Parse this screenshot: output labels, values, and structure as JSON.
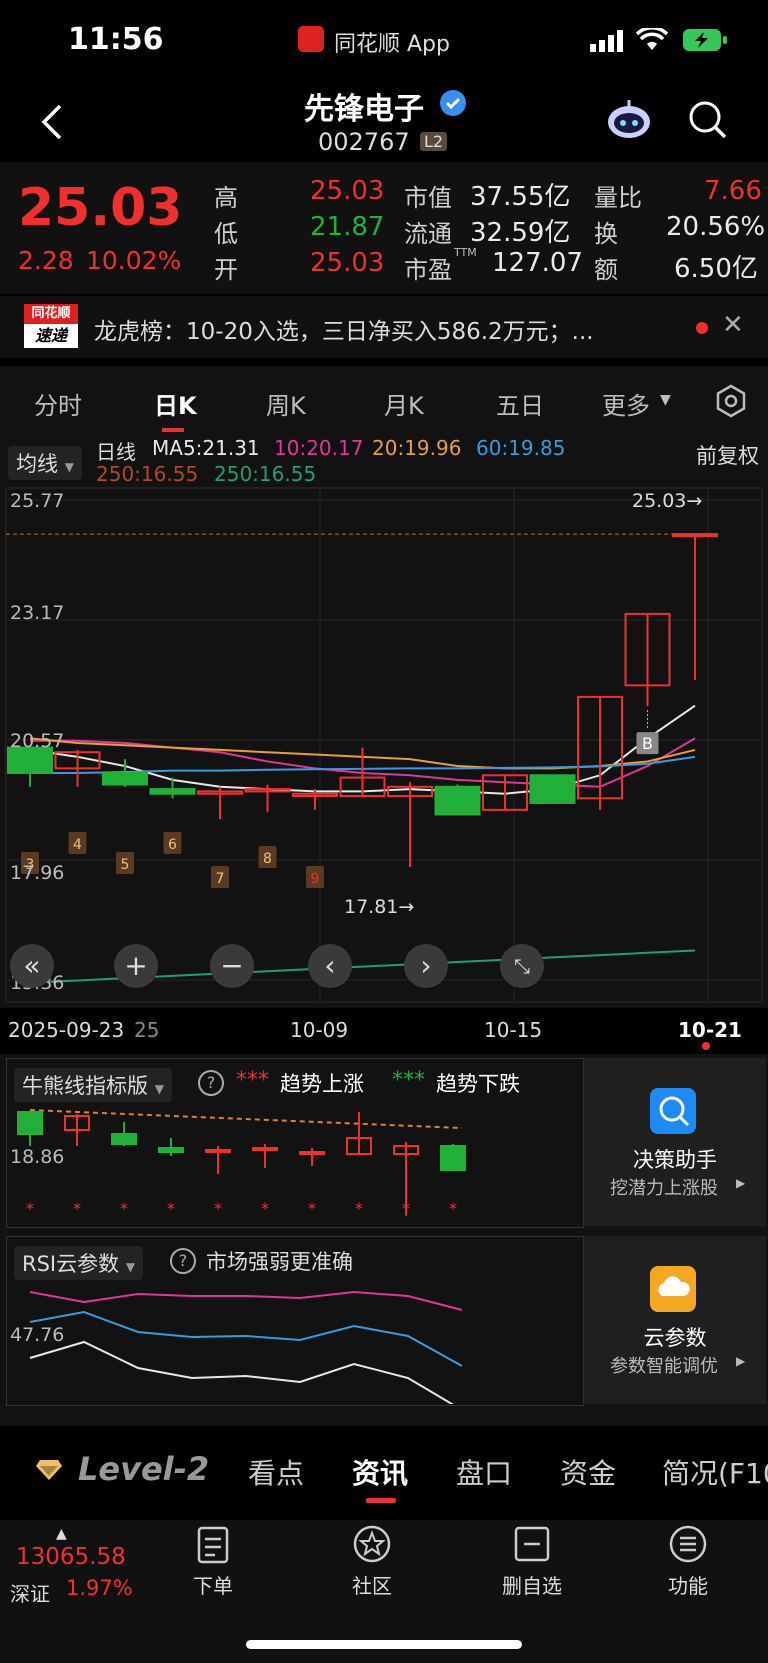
{
  "status_bar": {
    "time": "11:56",
    "app_label": "同花顺 App"
  },
  "header": {
    "stock_name": "先锋电子",
    "stock_code": "002767",
    "level_badge": "L2"
  },
  "quote": {
    "price": "25.03",
    "change": "2.28",
    "change_pct": "10.02%",
    "high_label": "高",
    "high": "25.03",
    "low_label": "低",
    "low": "21.87",
    "open_label": "开",
    "open": "25.03",
    "mktcap_label": "市值",
    "mktcap": "37.55亿",
    "float_label": "流通",
    "float": "32.59亿",
    "pe_label": "市盈",
    "pe_sup": "TTM",
    "pe": "127.07",
    "vol_ratio_label": "量比",
    "vol_ratio": "7.66",
    "turnover_label": "换",
    "turnover": "20.56%",
    "amount_label": "额",
    "amount": "6.50亿"
  },
  "news": {
    "badge_top": "同花顺",
    "badge_bottom": "速递",
    "text": "龙虎榜：10-20入选，三日净买入586.2万元；..."
  },
  "tabs": [
    "分时",
    "日K",
    "周K",
    "月K",
    "五日",
    "更多"
  ],
  "ma_bar": {
    "selector": "均线",
    "line_type": "日线",
    "ma5": "MA5:21.31",
    "ma10": "10:20.17",
    "ma20": "20:19.96",
    "ma60": "60:19.85",
    "ma250a": "250:16.55",
    "ma250b": "250:16.55",
    "adjust": "前复权"
  },
  "chart_data": {
    "type": "candlestick",
    "y_ticks": [
      "25.77",
      "23.17",
      "20.57",
      "17.96",
      "15.36"
    ],
    "x_labels": [
      "2025-09-23",
      "25",
      "10-09",
      "10-15",
      "10-21"
    ],
    "max_label": "25.03→",
    "min_label": "17.81→",
    "ylim": [
      15.36,
      25.77
    ],
    "candles": [
      {
        "o": 20.4,
        "c": 19.85,
        "h": 20.4,
        "l": 19.55
      },
      {
        "o": 19.95,
        "c": 20.3,
        "h": 20.35,
        "l": 19.55
      },
      {
        "o": 19.85,
        "c": 19.6,
        "h": 20.15,
        "l": 19.55
      },
      {
        "o": 19.5,
        "c": 19.4,
        "h": 19.75,
        "l": 19.3
      },
      {
        "o": 19.4,
        "c": 19.45,
        "h": 19.55,
        "l": 18.85
      },
      {
        "o": 19.45,
        "c": 19.5,
        "h": 19.6,
        "l": 19.0
      },
      {
        "o": 19.35,
        "c": 19.4,
        "h": 19.5,
        "l": 19.05
      },
      {
        "o": 19.35,
        "c": 19.75,
        "h": 20.4,
        "l": 19.35
      },
      {
        "o": 19.35,
        "c": 19.55,
        "h": 19.65,
        "l": 17.81
      },
      {
        "o": 19.55,
        "c": 18.95,
        "h": 19.6,
        "l": 18.95
      },
      {
        "o": 19.05,
        "c": 19.8,
        "h": 19.8,
        "l": 19.05
      },
      {
        "o": 19.8,
        "c": 19.2,
        "h": 19.8,
        "l": 19.2
      },
      {
        "o": 19.3,
        "c": 21.5,
        "h": 21.5,
        "l": 19.05
      },
      {
        "o": 21.75,
        "c": 23.3,
        "h": 23.3,
        "l": 21.3
      },
      {
        "o": 25.03,
        "c": 25.03,
        "h": 25.03,
        "l": 21.87
      }
    ],
    "signal_numbers": [
      "3",
      "4",
      "5",
      "6",
      "7",
      "8",
      "9"
    ],
    "buy_marker": "B",
    "series": [
      {
        "name": "MA5",
        "color": "#e8e8e8",
        "values": [
          20.35,
          20.2,
          20.0,
          19.7,
          19.55,
          19.5,
          19.45,
          19.45,
          19.5,
          19.45,
          19.4,
          19.5,
          19.8,
          20.6,
          21.31
        ]
      },
      {
        "name": "10",
        "color": "#e0359a",
        "values": [
          20.55,
          20.55,
          20.5,
          20.4,
          20.3,
          20.1,
          19.95,
          19.85,
          19.8,
          19.7,
          19.65,
          19.6,
          19.55,
          20.0,
          20.6
        ]
      },
      {
        "name": "20",
        "color": "#e8a030",
        "values": [
          20.6,
          20.5,
          20.45,
          20.4,
          20.35,
          20.3,
          20.25,
          20.2,
          20.15,
          20.0,
          19.95,
          19.95,
          20.0,
          20.1,
          20.35
        ]
      },
      {
        "name": "60",
        "color": "#3a9ae0",
        "values": [
          19.85,
          19.85,
          19.87,
          19.9,
          19.9,
          19.92,
          19.93,
          19.94,
          19.95,
          19.95,
          19.96,
          19.97,
          19.99,
          20.05,
          20.2
        ]
      },
      {
        "name": "250",
        "color": "#20a070",
        "values": [
          15.3,
          15.35,
          15.4,
          15.45,
          15.5,
          15.55,
          15.6,
          15.65,
          15.7,
          15.75,
          15.8,
          15.85,
          15.9,
          15.95,
          16.0
        ]
      }
    ]
  },
  "bull_bear": {
    "selector": "牛熊线指标版",
    "up_label": "趋势上涨",
    "down_label": "趋势下跌",
    "y_tick": "18.86",
    "panel_title": "决策助手",
    "panel_sub": "挖潜力上涨股"
  },
  "rsi": {
    "selector": "RSI云参数",
    "hint": "市场强弱更准确",
    "y_tick": "47.76",
    "panel_title": "云参数",
    "panel_sub": "参数智能调优"
  },
  "f10_tabs": {
    "level2": "Level-2",
    "items": [
      "看点",
      "资讯",
      "盘口",
      "资金",
      "简况(F10"
    ]
  },
  "bottom": {
    "index_value": "13065.58",
    "index_name": "深证",
    "index_pct": "1.97%",
    "items": [
      "下单",
      "社区",
      "删自选",
      "功能"
    ]
  },
  "colors": {
    "up": "#f0302f",
    "down": "#21b03a",
    "bg": "#121212"
  }
}
